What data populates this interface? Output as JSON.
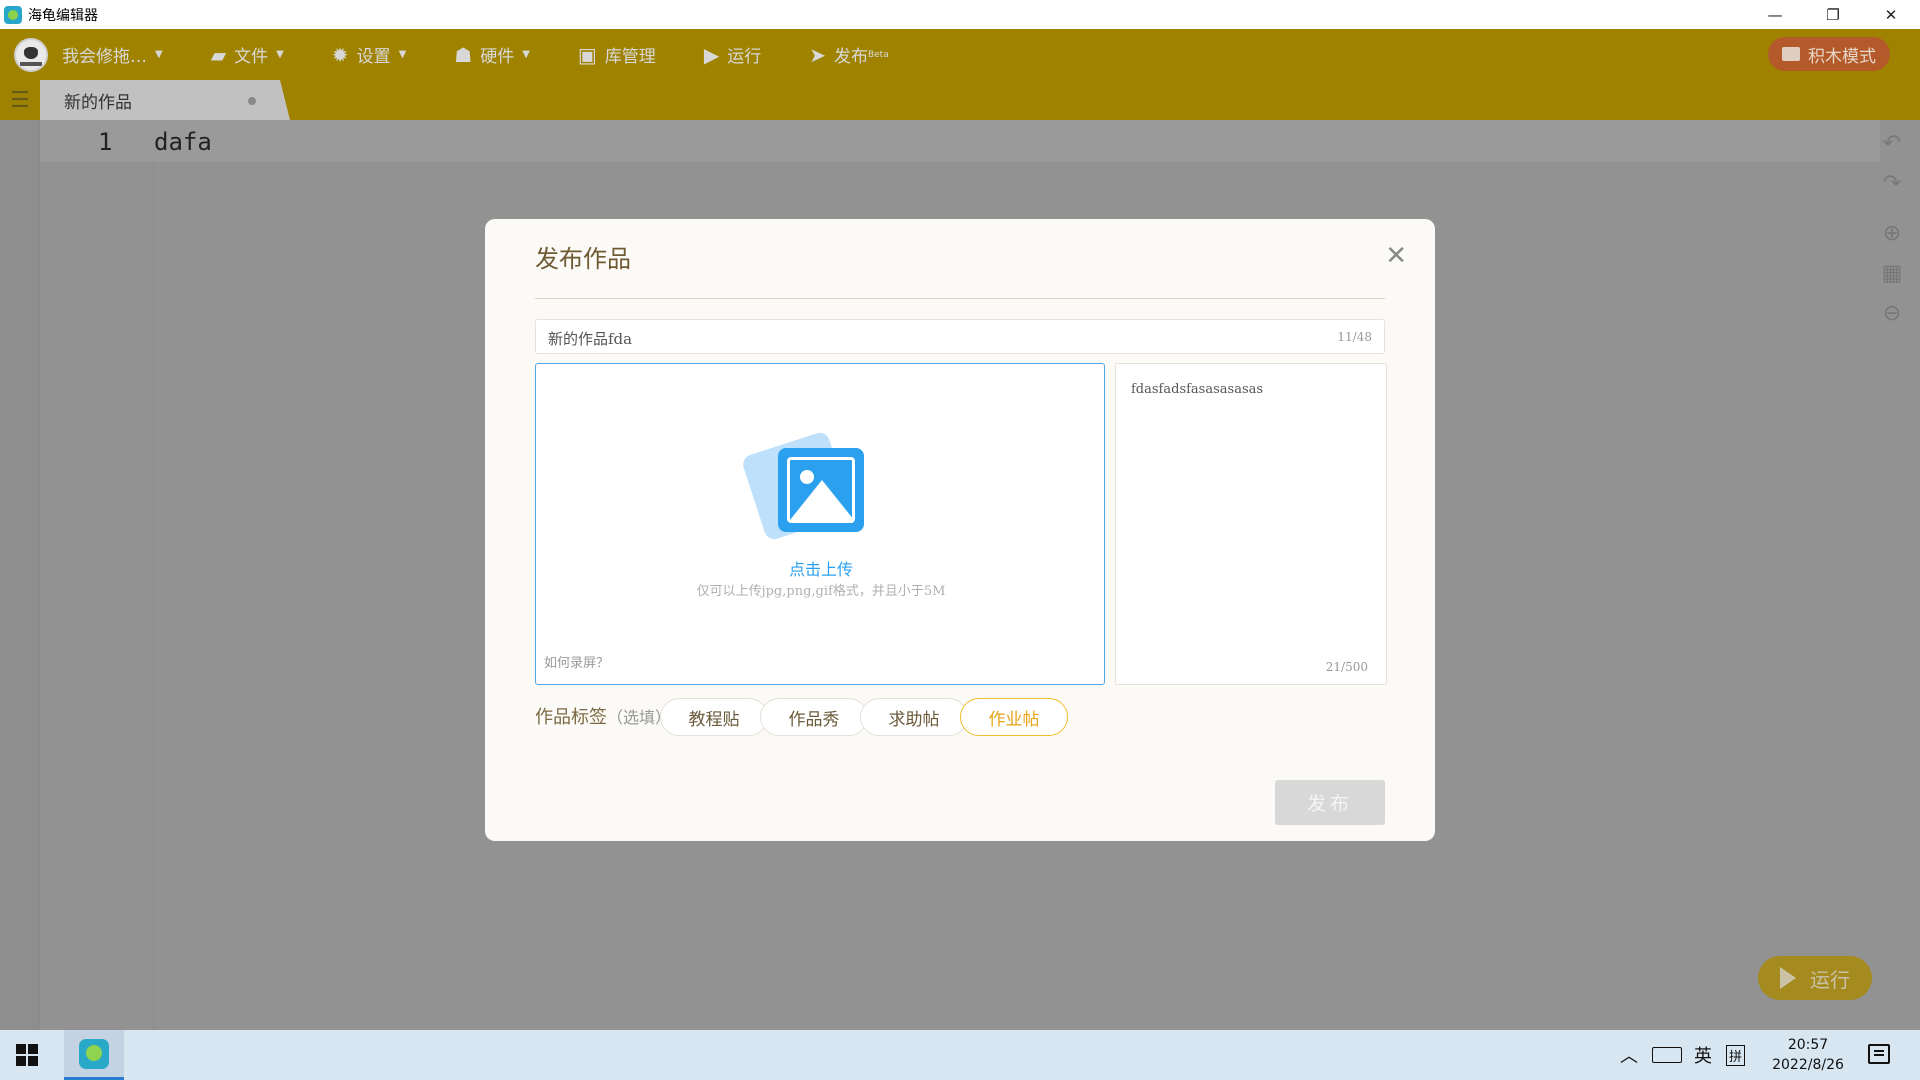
{
  "window": {
    "title": "海龟编辑器",
    "minimize": "—",
    "restore": "❐",
    "close": "✕"
  },
  "menubar": {
    "user": "我会修拖…",
    "file": "文件",
    "settings": "设置",
    "hardware": "硬件",
    "library": "库管理",
    "run": "运行",
    "publish": "发布",
    "publish_badge": "Beta",
    "block_mode": "积木模式"
  },
  "tabs": [
    {
      "label": "新的作品"
    }
  ],
  "editor": {
    "line_number": "1",
    "code": "dafa"
  },
  "run_button": "运行",
  "dialog": {
    "title": "发布作品",
    "name_value": "新的作品fda",
    "name_count": "11/48",
    "upload_title": "点击上传",
    "upload_hint": "仅可以上传jpg,png,gif格式，并且小于5M",
    "record_link": "如何录屏？",
    "description_value": "fdasfadsfasasasasas",
    "description_count": "21/500",
    "tags_label": "作品标签",
    "tags_optional": "（选填）",
    "tags": [
      {
        "label": "教程贴",
        "selected": false
      },
      {
        "label": "作品秀",
        "selected": false
      },
      {
        "label": "求助帖",
        "selected": false
      },
      {
        "label": "作业帖",
        "selected": true
      }
    ],
    "publish_button": "发布"
  },
  "taskbar": {
    "ime_lang": "英",
    "ime_mode": "拼",
    "time": "20:57",
    "date": "2022/8/26"
  },
  "colors": {
    "menubar_bg": "#9f8300",
    "accent_blue": "#2aa0ef",
    "tag_selected": "#f2bd2b"
  }
}
